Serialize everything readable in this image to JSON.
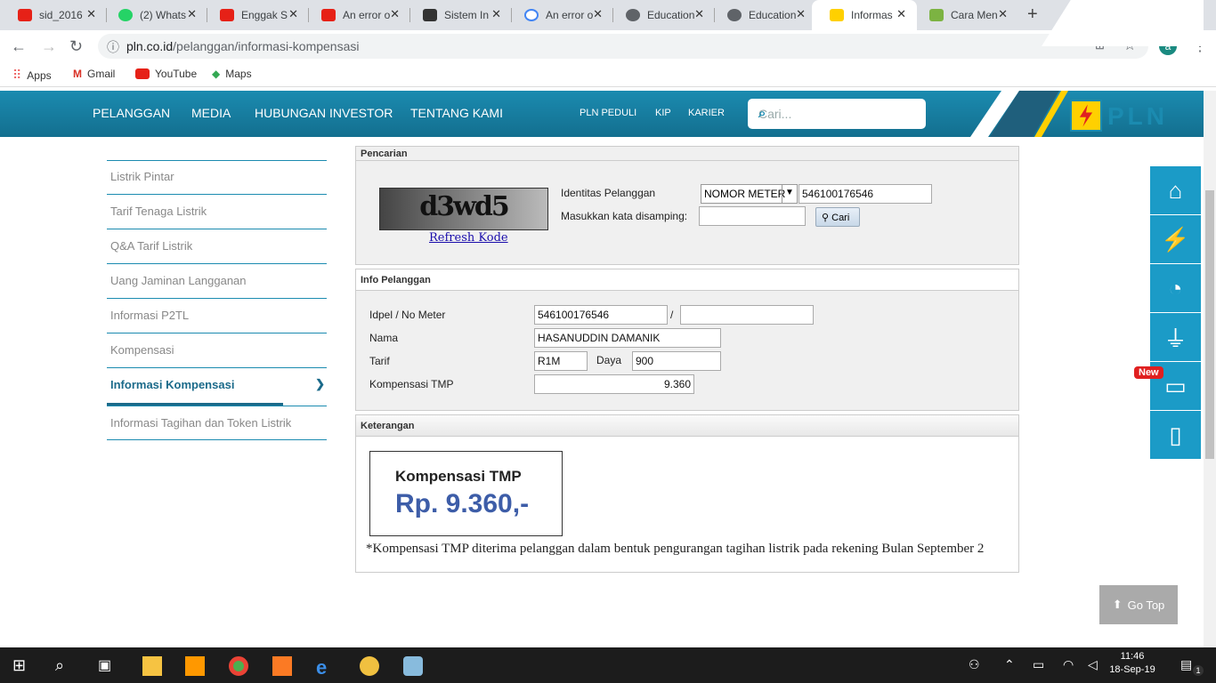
{
  "browser": {
    "tabs": [
      {
        "title": "sid_2016",
        "color": "#e62117"
      },
      {
        "title": "(2) Whats",
        "color": "#25d366"
      },
      {
        "title": "Enggak S",
        "color": "#e62117"
      },
      {
        "title": "An error o",
        "color": "#e62117"
      },
      {
        "title": "Sistem In",
        "color": "#333333"
      },
      {
        "title": "An error o",
        "color": "#4285f4"
      },
      {
        "title": "Education",
        "color": "#5f6368"
      },
      {
        "title": "Education",
        "color": "#5f6368"
      },
      {
        "title": "Informas",
        "color": "#ffd000"
      },
      {
        "title": "Cara Men",
        "color": "#7cb342"
      }
    ],
    "url_host": "pln.co.id",
    "url_path": "/pelanggan/informasi-kompensasi",
    "profile_initial": "a",
    "bookmarks": [
      "Apps",
      "Gmail",
      "YouTube",
      "Maps"
    ]
  },
  "site": {
    "nav": [
      "PELANGGAN",
      "MEDIA",
      "HUBUNGAN INVESTOR",
      "TENTANG KAMI"
    ],
    "subnav": [
      "PLN PEDULI",
      "KIP",
      "KARIER"
    ],
    "search_placeholder": "Cari...",
    "logo_text": "PLN"
  },
  "sidebar": {
    "items": [
      "Listrik Pintar",
      "Tarif Tenaga Listrik",
      "Q&A Tarif Listrik",
      "Uang Jaminan Langganan",
      "Informasi P2TL",
      "Kompensasi",
      "Informasi Kompensasi",
      "Informasi Tagihan dan Token Listrik"
    ]
  },
  "pencarian": {
    "title": "Pencarian",
    "captcha": "d3wd5",
    "refresh": "Refresh Kode",
    "identitas_label": "Identitas Pelanggan",
    "identitas_type": "NOMOR METER",
    "identitas_value": "546100176546",
    "kata_label": "Masukkan kata disamping:",
    "kata_value": "",
    "cari": "Cari"
  },
  "info": {
    "title": "Info Pelanggan",
    "idpel_label": "Idpel / No Meter",
    "idpel": "546100176546",
    "slash": "/",
    "meter": "",
    "nama_label": "Nama",
    "nama": "HASANUDDIN DAMANIK",
    "tarif_label": "Tarif",
    "tarif": "R1M",
    "daya_label": "Daya",
    "daya": "900",
    "kompensasi_label": "Kompensasi TMP",
    "kompensasi": "9.360"
  },
  "keterangan": {
    "title": "Keterangan",
    "box_title": "Kompensasi TMP",
    "box_value": "Rp. 9.360,-",
    "note": "*Kompensasi TMP diterima pelanggan dalam bentuk pengurangan tagihan listrik pada rekening Bulan September 2"
  },
  "floating": {
    "new_badge": "New",
    "go_top": "Go Top"
  },
  "taskbar": {
    "time": "11:46",
    "date": "18-Sep-19",
    "notif": "1"
  }
}
